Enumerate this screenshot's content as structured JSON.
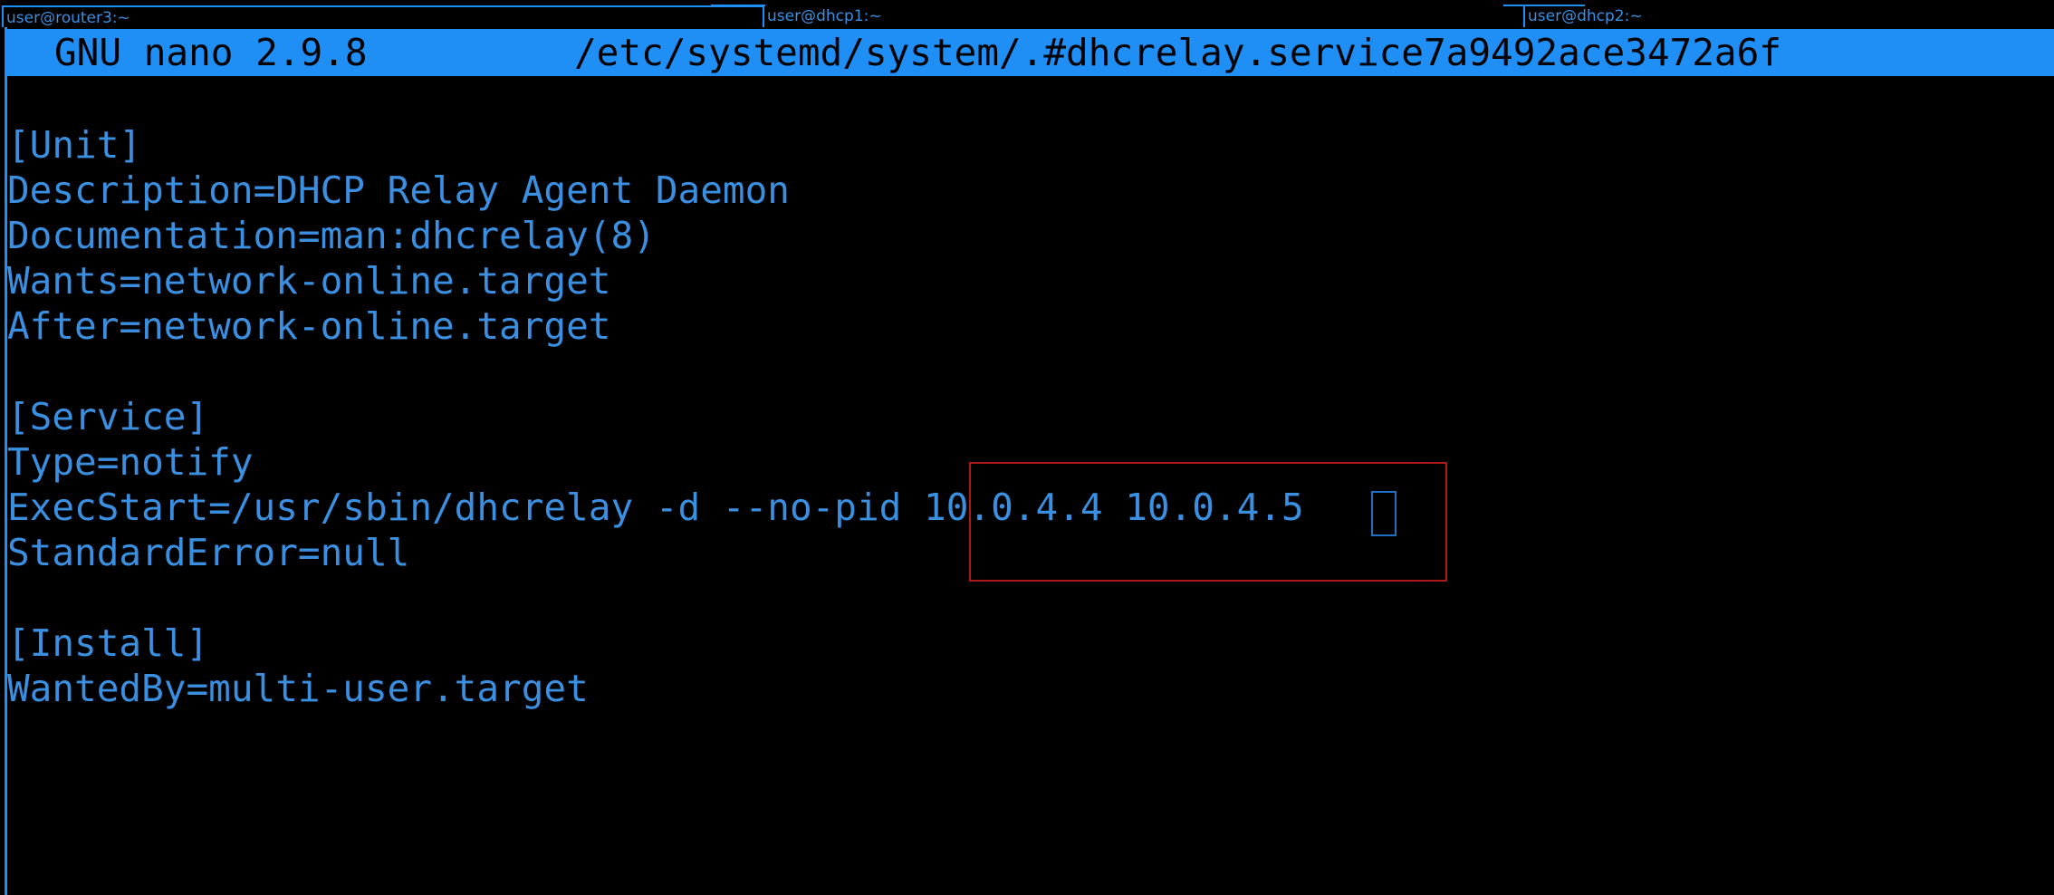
{
  "tabs": [
    {
      "label": "user@router3:~",
      "active": true
    },
    {
      "label": "user@dhcp1:~",
      "active": false
    },
    {
      "label": "user@dhcp2:~",
      "active": false
    }
  ],
  "nano": {
    "version": "GNU nano 2.9.8",
    "filename": "/etc/systemd/system/.#dhcrelay.service7a9492ace3472a6f"
  },
  "file_lines": [
    "[Unit]",
    "Description=DHCP Relay Agent Daemon",
    "Documentation=man:dhcrelay(8)",
    "Wants=network-online.target",
    "After=network-online.target",
    "",
    "[Service]",
    "Type=notify",
    "ExecStart=/usr/sbin/dhcrelay -d --no-pid 10.0.4.4 10.0.4.5",
    "StandardError=null",
    "",
    "[Install]",
    "WantedBy=multi-user.target"
  ],
  "colors": {
    "accent": "#1f8ef5",
    "text": "#3a8fe0",
    "background": "#000000",
    "highlight_box": "#b01818"
  }
}
